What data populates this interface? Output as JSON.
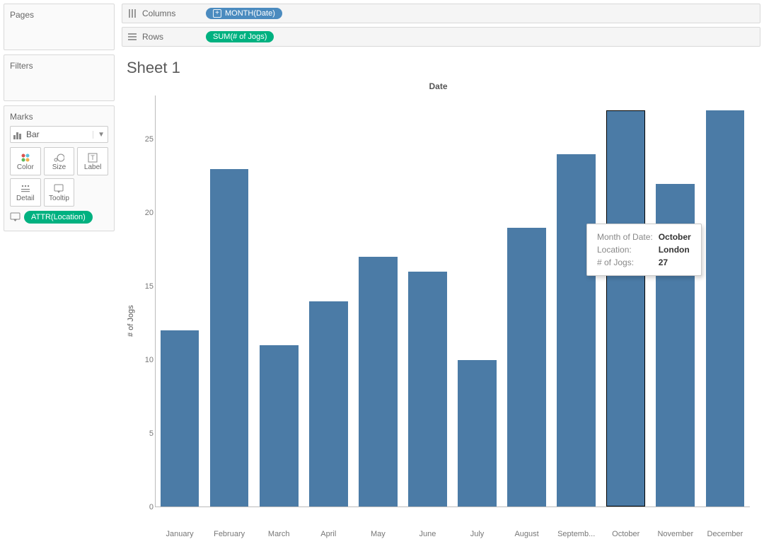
{
  "sidebar": {
    "pages_title": "Pages",
    "filters_title": "Filters",
    "marks_title": "Marks",
    "mark_type": "Bar",
    "mark_cells": {
      "color": "Color",
      "size": "Size",
      "label": "Label",
      "detail": "Detail",
      "tooltip": "Tooltip"
    },
    "attr_pill": "ATTR(Location)"
  },
  "shelves": {
    "columns_label": "Columns",
    "rows_label": "Rows",
    "columns_pill": "MONTH(Date)",
    "rows_pill": "SUM(# of Jogs)"
  },
  "sheet_title": "Sheet 1",
  "chart_axis_title_x": "Date",
  "chart_axis_title_y": "# of Jogs",
  "y_ticks": [
    0,
    5,
    10,
    15,
    20,
    25
  ],
  "tooltip": {
    "labels": {
      "month": "Month of Date:",
      "location": "Location:",
      "jogs": "# of Jogs:"
    },
    "values": {
      "month": "October",
      "location": "London",
      "jogs": "27"
    }
  },
  "chart_data": {
    "type": "bar",
    "title": "Date",
    "xlabel": "Date",
    "ylabel": "# of Jogs",
    "ylim": [
      0,
      28
    ],
    "categories": [
      "January",
      "February",
      "March",
      "April",
      "May",
      "June",
      "July",
      "August",
      "Septemb...",
      "October",
      "November",
      "December"
    ],
    "values": [
      12,
      23,
      11,
      14,
      17,
      16,
      10,
      19,
      24,
      27,
      22,
      27
    ],
    "selected_index": 9
  }
}
